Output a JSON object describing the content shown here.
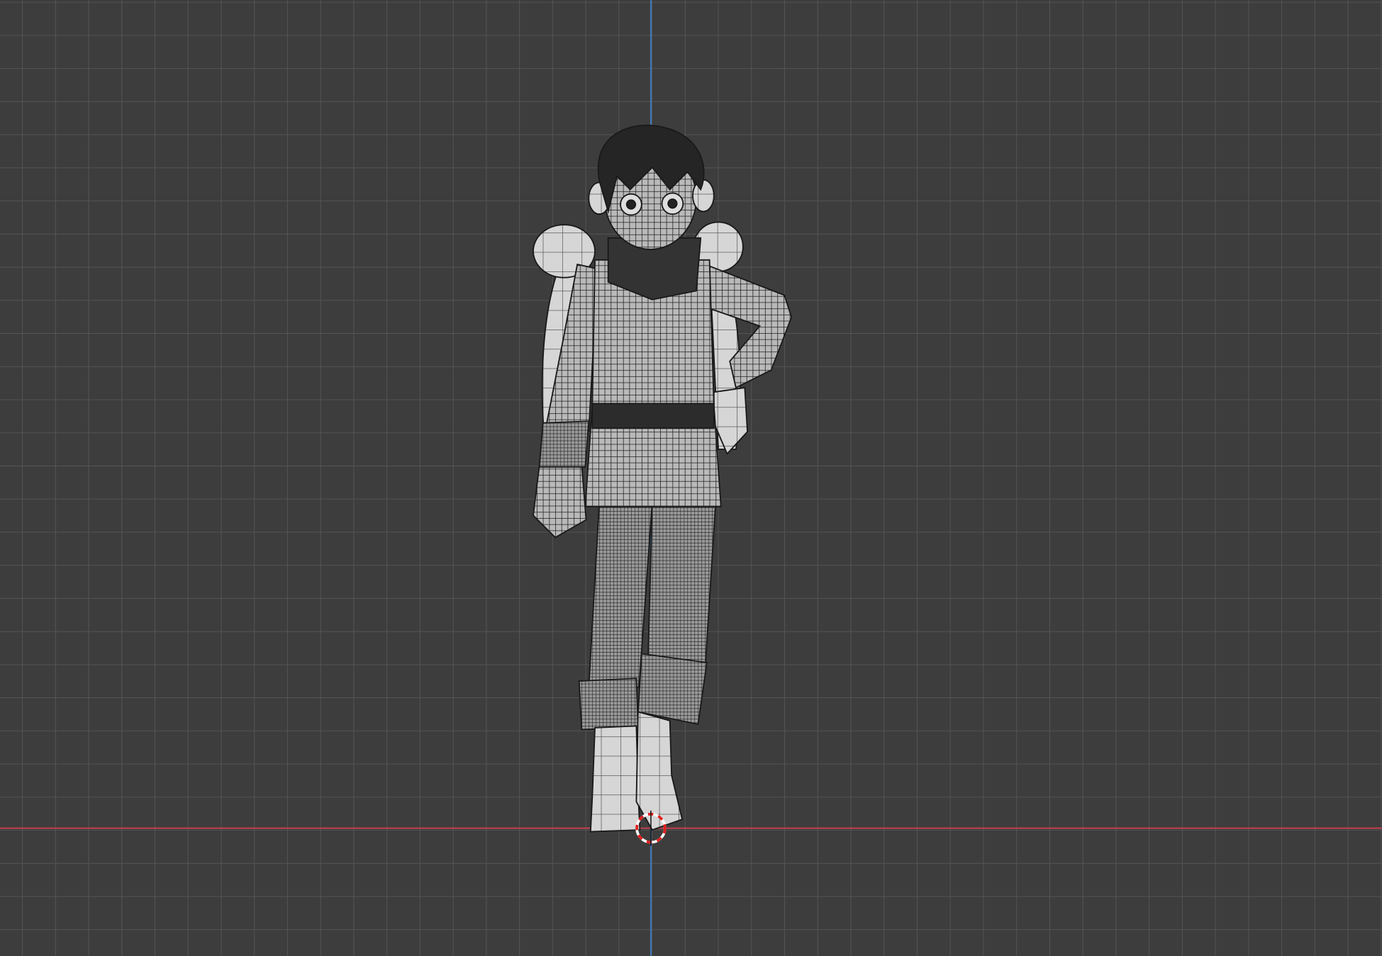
{
  "viewport": {
    "background_color": "#3d3d3d",
    "grid_color": "#545454",
    "x_axis_color": "#c2424f",
    "y_axis_color": "#3f7bbf",
    "shading": "solid-with-wireframe"
  },
  "scene": {
    "object": "character-mesh",
    "mesh_color": "#c8c8c8",
    "wire_color": "#1a1a1a"
  },
  "icons": [
    "3d-cursor-icon"
  ]
}
